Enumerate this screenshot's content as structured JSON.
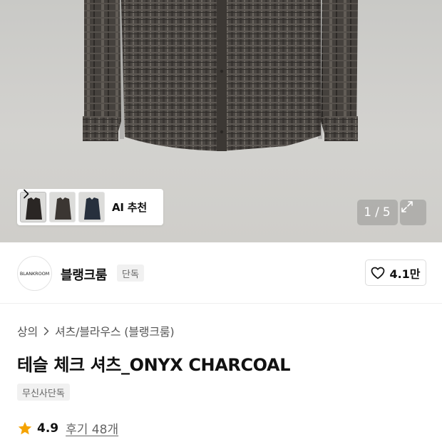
{
  "gallery": {
    "current_page": "1",
    "total_pages": "5",
    "separator": "/",
    "ai_recommend_label": "AI 추천",
    "thumbnails": [
      {
        "color": "#2a2624"
      },
      {
        "color": "#3b3632"
      },
      {
        "color": "#27303d"
      }
    ]
  },
  "brand": {
    "logo_text": "BLANKROOM",
    "name": "블랭크룸",
    "badge": "단독",
    "like_count": "4.1만"
  },
  "product": {
    "breadcrumb": [
      "상의",
      "셔츠/블라우스 (블랭크룸)"
    ],
    "title": "테슬 체크 셔츠_ONYX CHARCOAL",
    "tag": "무신사단독",
    "rating": "4.9",
    "review_label": "후기 48개"
  },
  "colors": {
    "star": "#f5a300",
    "badge_bg": "#f1f1f1"
  }
}
